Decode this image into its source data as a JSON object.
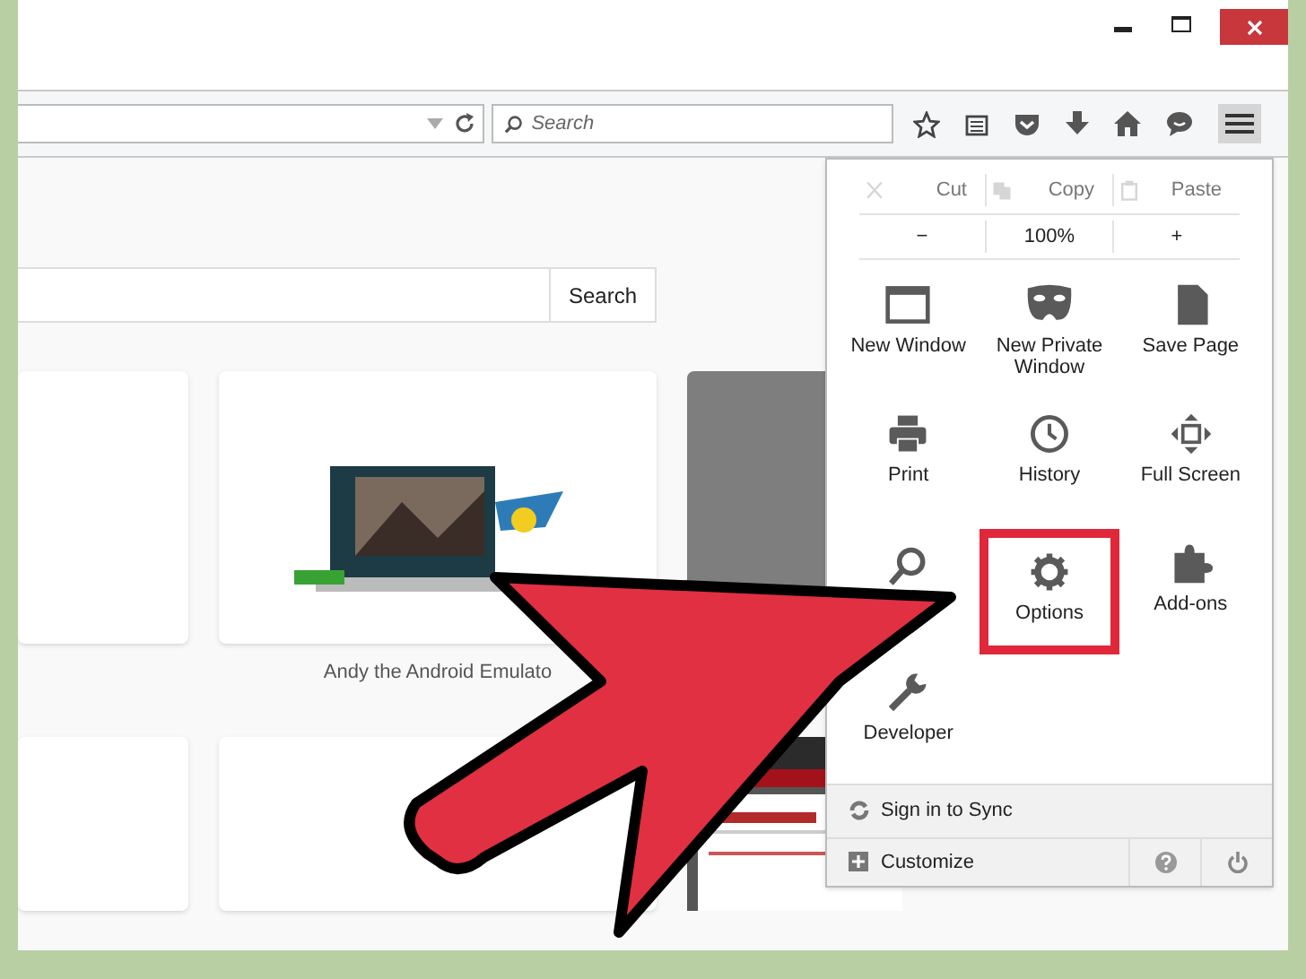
{
  "toolbar": {
    "search": {
      "placeholder": "Search"
    }
  },
  "page": {
    "search_button": "Search",
    "tiles": [
      {
        "kind": "blank"
      },
      {
        "kind": "picture",
        "caption": "Andy the Android Emulato"
      },
      {
        "kind": "gray"
      },
      {
        "kind": "blank"
      },
      {
        "kind": "blank"
      },
      {
        "kind": "picture"
      }
    ]
  },
  "menu": {
    "edit": [
      {
        "label": "Cut",
        "kind": "cut",
        "disabled": true
      },
      {
        "label": "Copy",
        "kind": "copy",
        "disabled": true
      },
      {
        "label": "Paste",
        "kind": "paste",
        "disabled": true
      }
    ],
    "zoom": {
      "out": "−",
      "level": "100%",
      "in": "+"
    },
    "items": [
      {
        "kind": "window",
        "label": "New Window",
        "selected": false
      },
      {
        "kind": "mask",
        "label": "New Private Window",
        "selected": false
      },
      {
        "kind": "page",
        "label": "Save Page",
        "selected": false
      },
      {
        "kind": "print",
        "label": "Print",
        "selected": false
      },
      {
        "kind": "clock",
        "label": "History",
        "selected": false
      },
      {
        "kind": "fullscreen",
        "label": "Full Screen",
        "selected": false
      },
      {
        "kind": "find",
        "selected": false
      },
      {
        "kind": "gear",
        "label": "Options",
        "selected": true
      },
      {
        "kind": "puzzle",
        "label": "Add-ons",
        "selected": false
      },
      {
        "kind": "wrench",
        "label": "Developer",
        "selected": false
      }
    ],
    "sync": "Sign in to Sync",
    "customize": "Customize"
  }
}
